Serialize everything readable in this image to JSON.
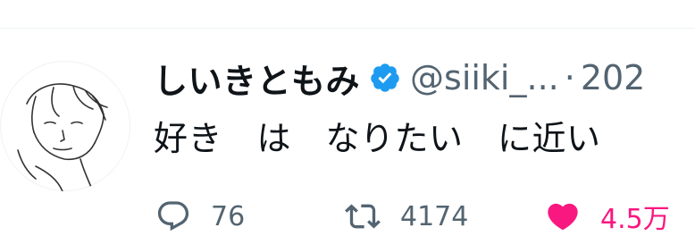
{
  "tweet": {
    "display_name": "しいきともみ",
    "handle": "@siiki_...",
    "separator": "·",
    "date": "202",
    "text": "好き　は　なりたい　に近い"
  },
  "actions": {
    "reply_count": "76",
    "retweet_count": "4174",
    "like_count": "4.5万"
  },
  "icons": {
    "avatar": "avatar-sketch",
    "verified": "verified-badge-icon",
    "reply": "reply-icon",
    "retweet": "retweet-icon",
    "like": "heart-icon"
  },
  "colors": {
    "verified": "#1d9bf0",
    "like": "#f91880",
    "muted": "#536471",
    "text": "#0f1419"
  }
}
